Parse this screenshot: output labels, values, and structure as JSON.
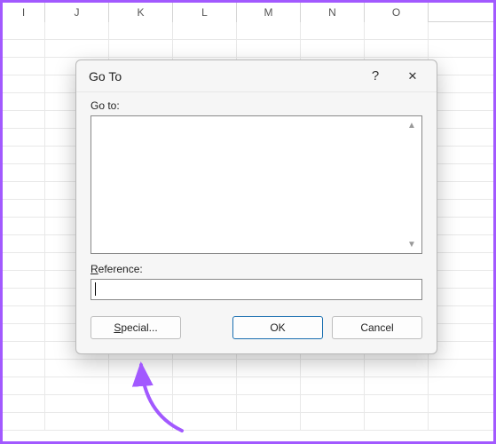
{
  "columns": [
    "I",
    "J",
    "K",
    "L",
    "M",
    "N",
    "O"
  ],
  "dialog": {
    "title": "Go To",
    "help": "?",
    "close": "✕",
    "goto_label": "Go to:",
    "reference_label": "Reference:",
    "reference_value": "",
    "special_prefix": "S",
    "special_rest": "pecial...",
    "ok": "OK",
    "cancel": "Cancel"
  }
}
